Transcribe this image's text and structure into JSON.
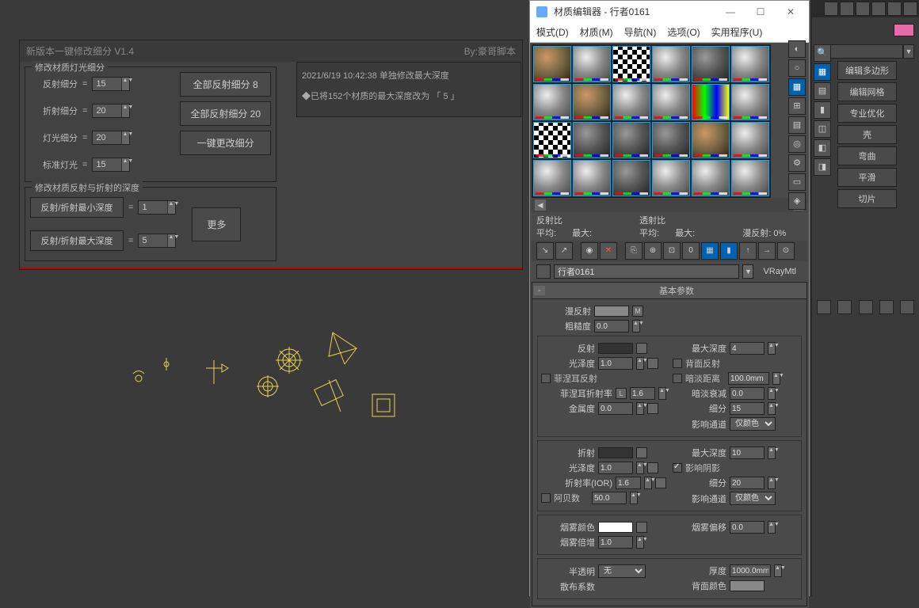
{
  "script_panel": {
    "title": "新版本一键修改细分 V1.4",
    "author": "By:豪哥脚本",
    "group1": {
      "legend": "修改材质灯光细分",
      "reflect_subdiv_label": "反射细分",
      "reflect_subdiv_value": "15",
      "refract_subdiv_label": "折射细分",
      "refract_subdiv_value": "20",
      "light_subdiv_label": "灯光细分",
      "light_subdiv_value": "20",
      "std_light_label": "标准灯光",
      "std_light_value": "15",
      "btn_all_reflect": "全部反射细分 8",
      "btn_all_reflect2": "全部反射细分 20",
      "btn_one_key": "一键更改细分"
    },
    "group2": {
      "legend": "修改材质反射与折射的深度",
      "min_depth_label": "反射/折射最小深度",
      "min_depth_value": "1",
      "max_depth_label": "反射/折射最大深度",
      "max_depth_value": "5",
      "btn_more": "更多"
    }
  },
  "log": {
    "line1": "2021/6/19 10:42:38    单独修改最大深度",
    "line2": "◆已将152个材质的最大深度改为 「 5 」"
  },
  "mat_editor": {
    "title": "材质编辑器 - 行者0161",
    "menu": {
      "mode": "模式(D)",
      "material": "材质(M)",
      "nav": "导航(N)",
      "options": "选项(O)",
      "utilities": "实用程序(U)"
    },
    "ratio": {
      "reflect_label": "反射比",
      "avg": "平均:",
      "max": "最大:",
      "transmit_label": "透射比",
      "diffuse": "漫反射:",
      "diffuse_val": "0%"
    },
    "material_name": "行者0161",
    "material_type": "VRayMtl",
    "rollout_title": "基本参数",
    "diffuse_label": "漫反射",
    "roughness_label": "粗糙度",
    "roughness_val": "0.0",
    "m_btn": "M",
    "reflect": {
      "label": "反射",
      "gloss_label": "光泽度",
      "gloss_val": "1.0",
      "fresnel_label": "菲涅耳反射",
      "fresnel_ior_label": "菲涅耳折射率",
      "fresnel_ior_l": "L",
      "fresnel_ior_val": "1.6",
      "metal_label": "金属度",
      "metal_val": "0.0",
      "max_depth_label": "最大深度",
      "max_depth_val": "4",
      "backface_label": "背面反射",
      "dim_dist_label": "暗淡距离",
      "dim_dist_val": "100.0mm",
      "dim_falloff_label": "暗淡衰减",
      "dim_falloff_val": "0.0",
      "subdiv_label": "细分",
      "subdiv_val": "15",
      "affect_label": "影响通道",
      "affect_val": "仅颜色"
    },
    "refract": {
      "label": "折射",
      "gloss_label": "光泽度",
      "gloss_val": "1.0",
      "ior_label": "折射率(IOR)",
      "ior_val": "1.6",
      "abbe_label": "阿贝数",
      "abbe_val": "50.0",
      "max_depth_label": "最大深度",
      "max_depth_val": "10",
      "shadow_label": "影响阴影",
      "subdiv_label": "细分",
      "subdiv_val": "20",
      "affect_label": "影响通道",
      "affect_val": "仅颜色"
    },
    "fog": {
      "color_label": "烟雾颜色",
      "mult_label": "烟雾倍增",
      "mult_val": "1.0",
      "bias_label": "烟雾偏移",
      "bias_val": "0.0"
    },
    "sss": {
      "label": "半透明",
      "type": "无",
      "thick_label": "厚度",
      "thick_val": "1000.0mm",
      "scatter_label": "散布系数",
      "back_label": "背面颜色"
    }
  },
  "right_panel": {
    "buttons": [
      "编辑多边形",
      "编辑网格",
      "专业优化",
      "壳",
      "弯曲",
      "平滑",
      "切片"
    ]
  }
}
